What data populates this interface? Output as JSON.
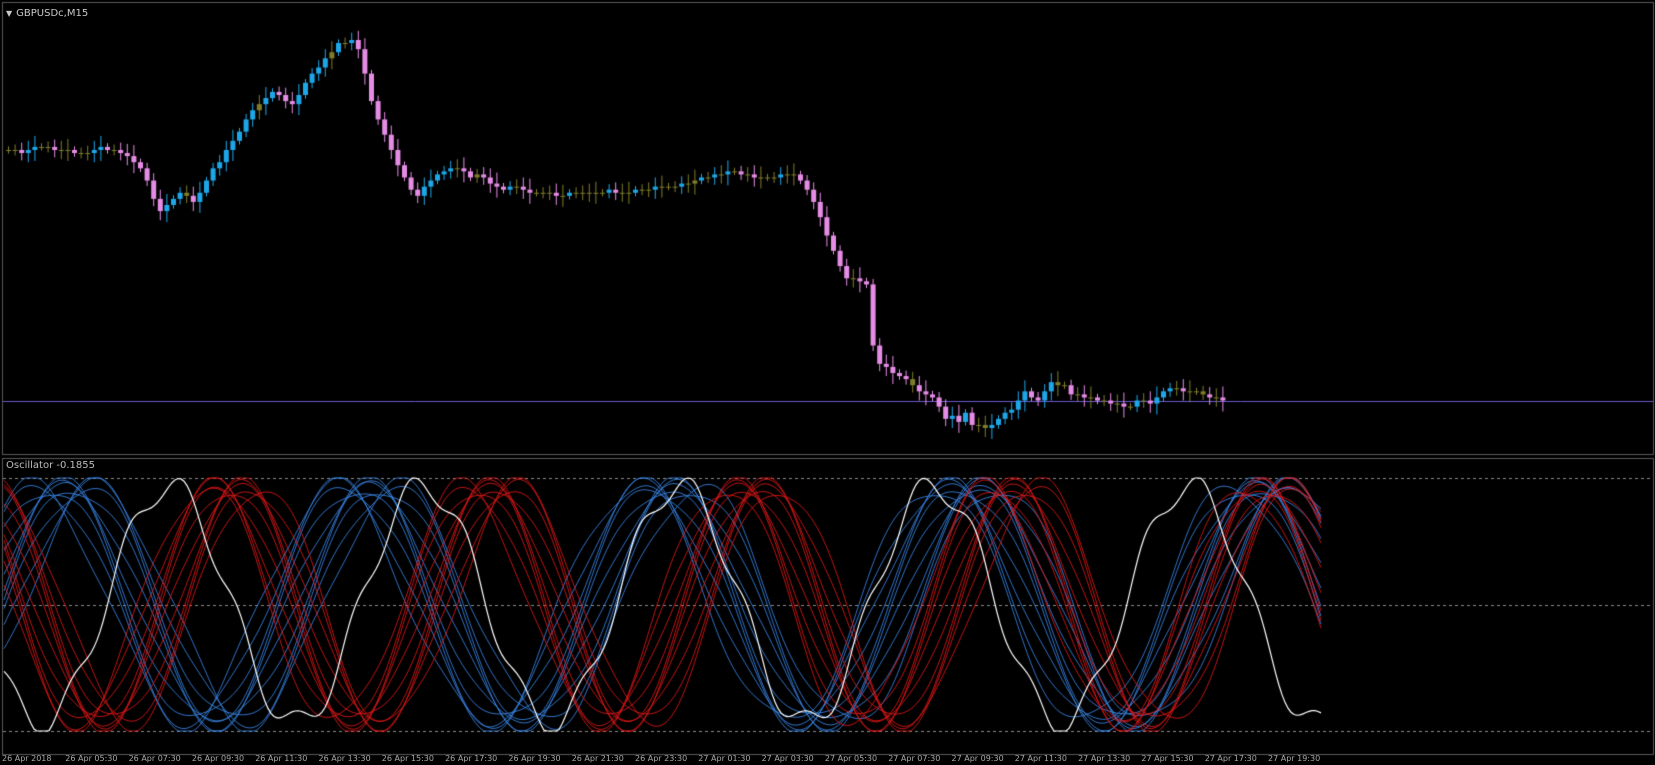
{
  "main_window": {
    "title": "GBPUSDc,M15",
    "collapse_icon": "triangle-down-icon"
  },
  "oscillator_window": {
    "label": "Oscillator -0.1855",
    "level_lines": 3
  },
  "x_axis": {
    "labels": [
      "26 Apr 2018",
      "26 Apr 05:30",
      "26 Apr 07:30",
      "26 Apr 09:30",
      "26 Apr 11:30",
      "26 Apr 13:30",
      "26 Apr 15:30",
      "26 Apr 17:30",
      "26 Apr 19:30",
      "26 Apr 21:30",
      "26 Apr 23:30",
      "27 Apr 01:30",
      "27 Apr 03:30",
      "27 Apr 05:30",
      "27 Apr 07:30",
      "27 Apr 09:30",
      "27 Apr 11:30",
      "27 Apr 13:30",
      "27 Apr 15:30",
      "27 Apr 17:30",
      "27 Apr 19:30"
    ]
  },
  "colors": {
    "background": "#000000",
    "frame": "#5a5a5a",
    "candle_bull": "#1ea7e8",
    "candle_bear": "#e58ce5",
    "candle_neutral": "#7f7d2a",
    "horizontal_line": "#6a5acd",
    "osc_red": "#e01818",
    "osc_blue": "#3a86e8",
    "osc_white": "#ffffff",
    "level_line": "#8a8a8a"
  },
  "chart_data": {
    "type": "candlestick",
    "symbol_timeframe": "GBPUSDc,M15",
    "closes": [
      0.6,
      0.6,
      0.59,
      0.6,
      0.61,
      0.61,
      0.61,
      0.6,
      0.6,
      0.6,
      0.59,
      0.59,
      0.59,
      0.6,
      0.61,
      0.6,
      0.6,
      0.59,
      0.58,
      0.56,
      0.54,
      0.5,
      0.44,
      0.4,
      0.42,
      0.44,
      0.46,
      0.45,
      0.43,
      0.46,
      0.5,
      0.54,
      0.56,
      0.6,
      0.63,
      0.66,
      0.7,
      0.73,
      0.75,
      0.77,
      0.79,
      0.78,
      0.76,
      0.75,
      0.78,
      0.82,
      0.85,
      0.87,
      0.9,
      0.92,
      0.95,
      0.95,
      0.96,
      0.93,
      0.85,
      0.76,
      0.7,
      0.65,
      0.6,
      0.55,
      0.51,
      0.47,
      0.45,
      0.48,
      0.5,
      0.52,
      0.53,
      0.54,
      0.54,
      0.53,
      0.51,
      0.52,
      0.51,
      0.49,
      0.48,
      0.47,
      0.48,
      0.48,
      0.47,
      0.46,
      0.46,
      0.46,
      0.46,
      0.45,
      0.45,
      0.46,
      0.46,
      0.46,
      0.46,
      0.46,
      0.46,
      0.47,
      0.46,
      0.46,
      0.46,
      0.47,
      0.47,
      0.47,
      0.48,
      0.48,
      0.48,
      0.48,
      0.49,
      0.49,
      0.5,
      0.51,
      0.51,
      0.52,
      0.52,
      0.53,
      0.53,
      0.52,
      0.52,
      0.51,
      0.51,
      0.51,
      0.51,
      0.52,
      0.52,
      0.52,
      0.5,
      0.47,
      0.43,
      0.38,
      0.32,
      0.27,
      0.22,
      0.18,
      0.18,
      0.17,
      0.16,
      -0.04,
      -0.1,
      -0.11,
      -0.13,
      -0.14,
      -0.15,
      -0.17,
      -0.19,
      -0.2,
      -0.21,
      -0.24,
      -0.28,
      -0.27,
      -0.29,
      -0.26,
      -0.3,
      -0.3,
      -0.31,
      -0.3,
      -0.28,
      -0.26,
      -0.25,
      -0.22,
      -0.19,
      -0.21,
      -0.22,
      -0.19,
      -0.16,
      -0.17,
      -0.17,
      -0.2,
      -0.2,
      -0.21,
      -0.21,
      -0.22,
      -0.22,
      -0.23,
      -0.23,
      -0.24,
      -0.24,
      -0.22,
      -0.22,
      -0.23,
      -0.21,
      -0.19,
      -0.18,
      -0.18,
      -0.19,
      -0.19,
      -0.19,
      -0.2,
      -0.21,
      -0.21,
      -0.22
    ],
    "horizontal_line_value": -0.22,
    "oscillator": {
      "name": "Oscillator",
      "current_value": -0.1855,
      "levels": [
        80,
        50,
        20
      ]
    }
  }
}
